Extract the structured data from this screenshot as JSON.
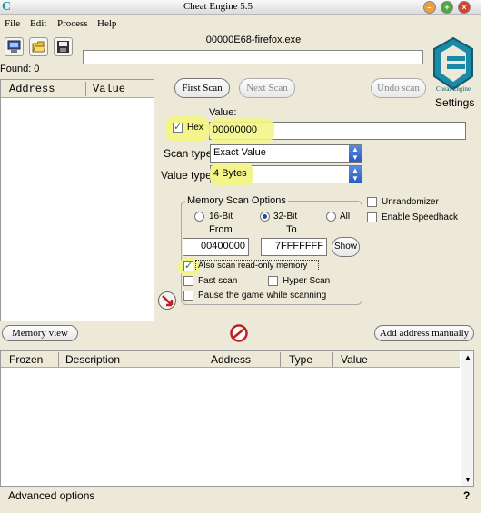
{
  "window": {
    "title": "Cheat Engine 5.5",
    "logo_letter": "C"
  },
  "menu": {
    "file": "File",
    "edit": "Edit",
    "process": "Process",
    "help": "Help"
  },
  "toolbar": {
    "open_process_icon": "computer-icon",
    "open_file_icon": "folder-open-icon",
    "save_icon": "floppy-disk-icon"
  },
  "process_name": "00000E68-firefox.exe",
  "found_label": "Found: 0",
  "address_list": {
    "col_address": "Address",
    "col_value": "Value"
  },
  "scan_buttons": {
    "first_scan": "First Scan",
    "next_scan": "Next Scan",
    "undo_scan": "Undo scan"
  },
  "settings_label": "Settings",
  "logo_caption": "Cheat Engine",
  "value": {
    "label": "Value:",
    "hex_label": "Hex",
    "text": "00000000"
  },
  "scan_type": {
    "label": "Scan type",
    "selected": "Exact Value"
  },
  "value_type": {
    "label": "Value type",
    "selected": "4 Bytes"
  },
  "memory_options": {
    "legend": "Memory Scan Options",
    "bit16": "16-Bit",
    "bit32": "32-Bit",
    "all": "All",
    "from_label": "From",
    "to_label": "To",
    "from_value": "00400000",
    "to_value": "7FFFFFFF",
    "show_button": "Show",
    "readonly_label": "Also scan read-only memory",
    "fast_scan": "Fast scan",
    "hyper_scan": "Hyper Scan",
    "pause_game": "Pause the game while scanning"
  },
  "options": {
    "unrandomizer": "Unrandomizer",
    "speedhack": "Enable Speedhack"
  },
  "memory_view_button": "Memory view",
  "add_address_button": "Add address manually",
  "cheat_table": {
    "col_frozen": "Frozen",
    "col_description": "Description",
    "col_address": "Address",
    "col_type": "Type",
    "col_value": "Value"
  },
  "advanced_options": "Advanced options",
  "help_mark": "?",
  "colors": {
    "highlight": "#f3f58a",
    "logo": "#1b8aa8",
    "window_bg": "#ece9d8"
  }
}
